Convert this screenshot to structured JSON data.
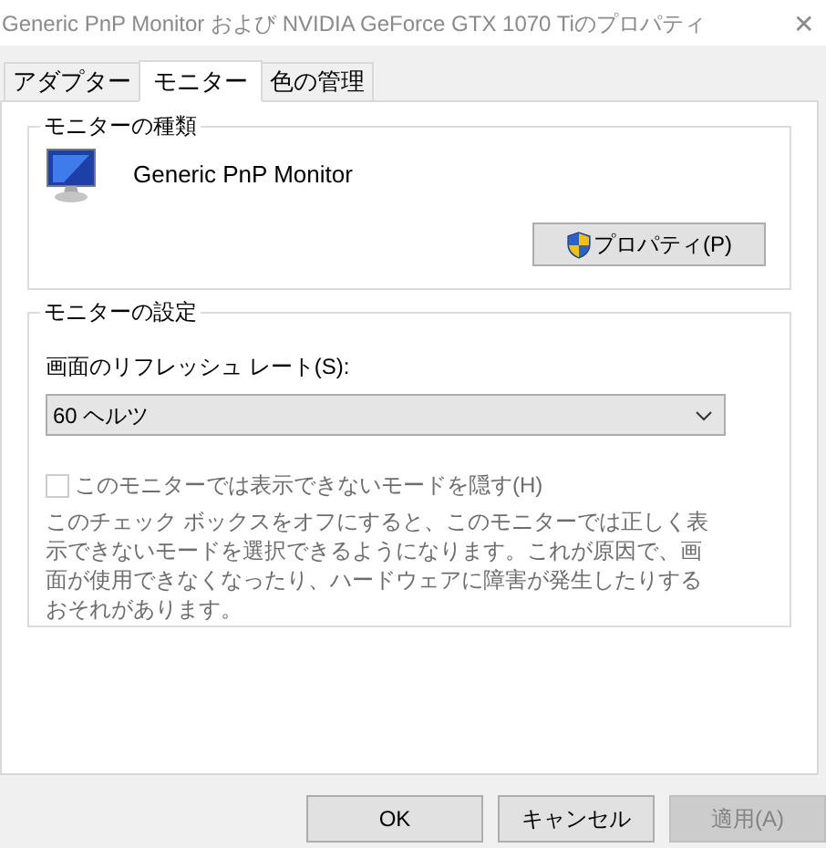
{
  "window": {
    "title": "Generic PnP Monitor および NVIDIA GeForce GTX 1070 Tiのプロパティ",
    "close": "✕"
  },
  "tabs": [
    {
      "label": "アダプター",
      "selected": false
    },
    {
      "label": "モニター",
      "selected": true
    },
    {
      "label": "色の管理",
      "selected": false
    }
  ],
  "monitor_type": {
    "heading": "モニターの種類",
    "name": "Generic PnP Monitor",
    "button": "プロパティ(P)"
  },
  "monitor_settings": {
    "heading": "モニターの設定",
    "refresh_label": "画面のリフレッシュ レート(S):",
    "refresh_value": "60 ヘルツ",
    "checkbox": {
      "label": "このモニターでは表示できないモードを隠す(H)",
      "checked": false,
      "disabled": true
    },
    "description": "このチェック ボックスをオフにすると、このモニターでは正しく表示できないモードを選択できるようになります。これが原因で、画面が使用できなくなったり、ハードウェアに障害が発生したりするおそれがあります。"
  },
  "buttons": [
    {
      "label": "OK",
      "disabled": false
    },
    {
      "label": "キャンセル",
      "disabled": false
    },
    {
      "label": "適用(A)",
      "disabled": true
    }
  ]
}
